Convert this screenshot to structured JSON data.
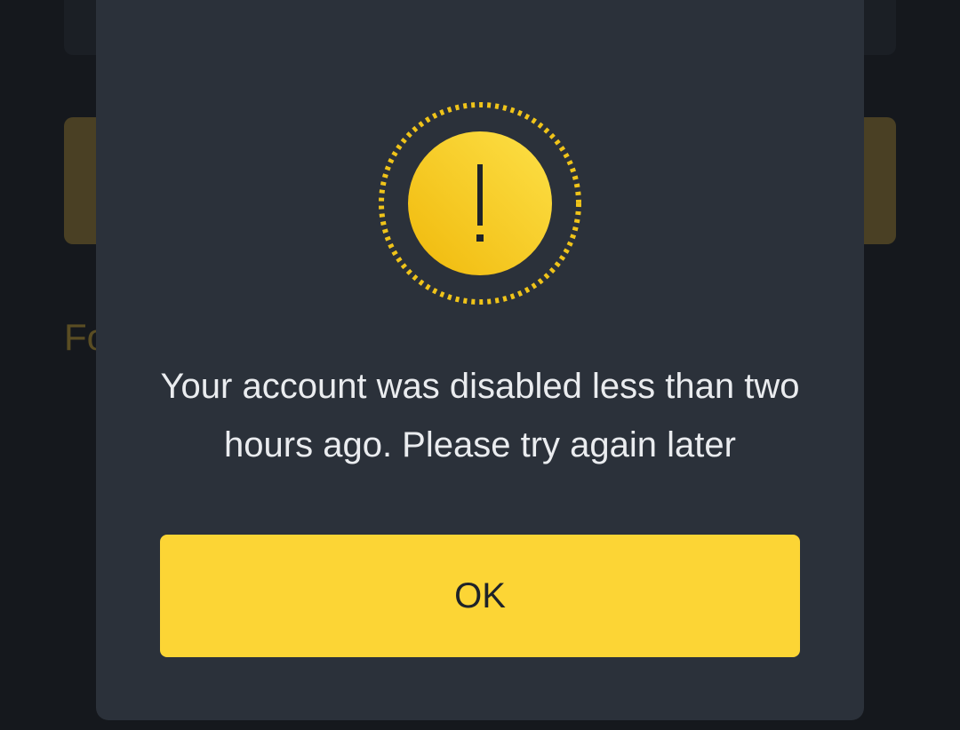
{
  "background": {
    "link_text": "Fo"
  },
  "dialog": {
    "icon": "warning-exclamation-icon",
    "message": "Your account was disabled less than two hours ago. Please try again later",
    "ok_label": "OK"
  },
  "colors": {
    "accent": "#fcd535",
    "dialog_bg": "#2b313a",
    "page_bg": "#15181d",
    "text": "#eaecef"
  }
}
